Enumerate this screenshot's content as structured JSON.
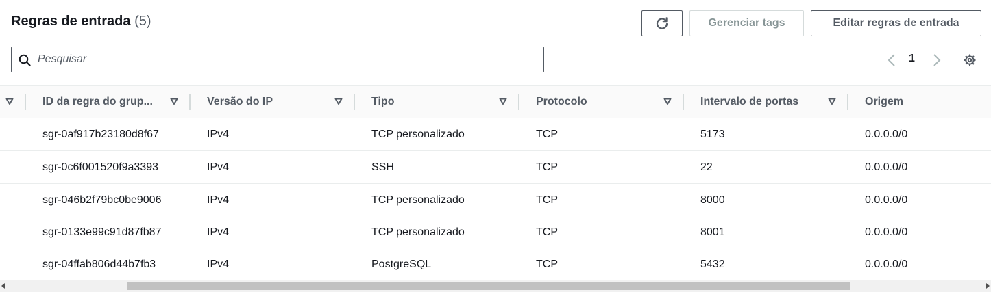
{
  "header": {
    "title": "Regras de entrada",
    "count": "(5)"
  },
  "toolbar": {
    "refresh_icon": "refresh-icon",
    "manage_tags_label": "Gerenciar tags",
    "edit_rules_label": "Editar regras de entrada"
  },
  "search": {
    "placeholder": "Pesquisar",
    "icon": "search-icon"
  },
  "pagination": {
    "current_page": "1",
    "prev_icon": "chevron-left-icon",
    "next_icon": "chevron-right-icon",
    "settings_icon": "gear-icon"
  },
  "colors": {
    "primary_text": "#16191f",
    "secondary_text": "#545b64",
    "disabled_text": "#879596",
    "border": "#eaeded",
    "header_bg": "#fafafa"
  },
  "table": {
    "columns": [
      {
        "label": "ID da regra do grup...",
        "sortable": true
      },
      {
        "label": "Versão do IP",
        "sortable": true
      },
      {
        "label": "Tipo",
        "sortable": true
      },
      {
        "label": "Protocolo",
        "sortable": true
      },
      {
        "label": "Intervalo de portas",
        "sortable": true
      },
      {
        "label": "Origem",
        "sortable": false
      }
    ],
    "rows": [
      [
        "sgr-0af917b23180d8f67",
        "IPv4",
        "TCP personalizado",
        "TCP",
        "5173",
        "0.0.0.0/0"
      ],
      [
        "sgr-0c6f001520f9a3393",
        "IPv4",
        "SSH",
        "TCP",
        "22",
        "0.0.0.0/0"
      ],
      [
        "sgr-046b2f79bc0be9006",
        "IPv4",
        "TCP personalizado",
        "TCP",
        "8000",
        "0.0.0.0/0"
      ],
      [
        "sgr-0133e99c91d87fb87",
        "IPv4",
        "TCP personalizado",
        "TCP",
        "8001",
        "0.0.0.0/0"
      ],
      [
        "sgr-04ffab806d44b7fb3",
        "IPv4",
        "PostgreSQL",
        "TCP",
        "5432",
        "0.0.0.0/0"
      ]
    ]
  }
}
